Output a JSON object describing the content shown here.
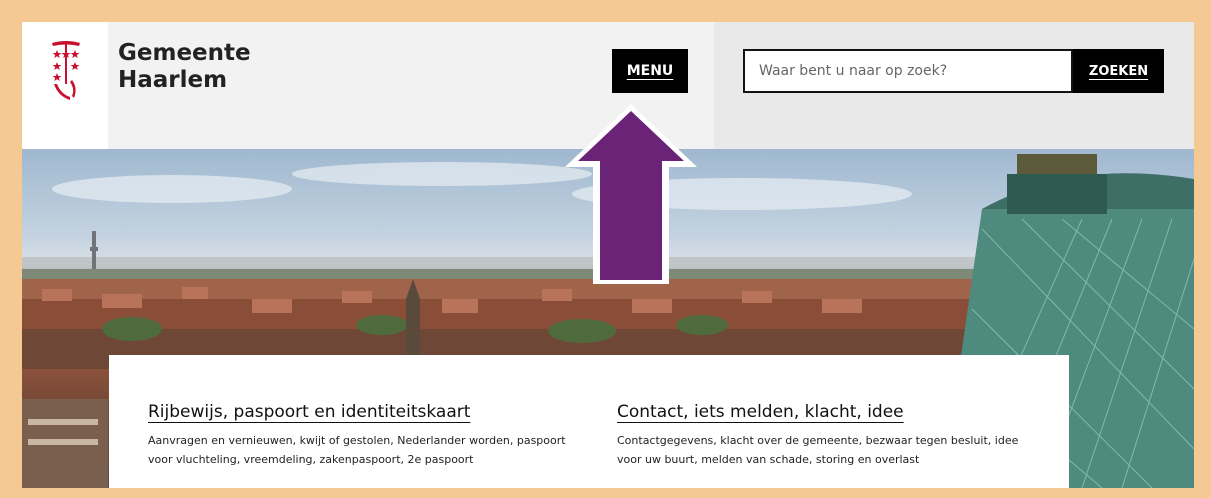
{
  "header": {
    "brand_line1": "Gemeente",
    "brand_line2": "Haarlem",
    "menu_label": "MENU"
  },
  "search": {
    "placeholder": "Waar bent u naar op zoek?",
    "button_label": "ZOEKEN"
  },
  "cards": [
    {
      "title": "Rijbewijs, paspoort en identiteitskaart",
      "description": "Aanvragen en vernieuwen, kwijt of gestolen, Nederlander worden, paspoort voor vluchteling, vreemdeling, zakenpaspoort, 2e paspoort"
    },
    {
      "title": "Contact, iets melden, klacht, idee",
      "description": "Contactgegevens, klacht over de gemeente, bezwaar tegen besluit, idee voor uw buurt, melden van schade, storing en overlast"
    }
  ],
  "colors": {
    "frame_border": "#f5c993",
    "arrow": "#6a2377",
    "logo_red": "#c8102e",
    "button_bg": "#000000"
  },
  "icons": {
    "logo": "haarlem-coat-of-arms-icon",
    "annotation": "up-arrow-annotation"
  }
}
